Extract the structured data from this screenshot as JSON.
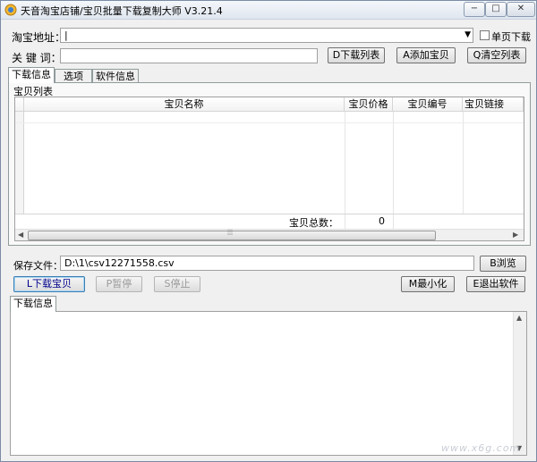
{
  "window": {
    "title": "天音淘宝店铺/宝贝批量下载复制大师 V3.21.4",
    "minimize": "−",
    "maximize": "□",
    "close": "✕"
  },
  "form": {
    "url_label": "淘宝地址：",
    "url_value": "|",
    "single_page_label": "单页下载",
    "keyword_label": "关 键 词：",
    "keyword_value": ""
  },
  "buttons": {
    "download_list": "D下载列表",
    "add_item": "A添加宝贝",
    "clear_list": "Q清空列表",
    "browse": "B浏览",
    "download_items": "L下载宝贝",
    "pause": "P暂停",
    "stop": "S停止",
    "minimize": "M最小化",
    "exit": "E退出软件"
  },
  "tabs": [
    "下载信息",
    "选项",
    "软件信息"
  ],
  "item_list": {
    "group_label": "宝贝列表",
    "columns": [
      "宝贝名称",
      "宝贝价格",
      "宝贝编号",
      "宝贝链接"
    ],
    "total_label": "宝贝总数：",
    "total_value": "0"
  },
  "save": {
    "label": "保存文件：",
    "path": "D:\\1\\csv12271558.csv"
  },
  "log": {
    "tab_label": "下载信息"
  },
  "watermark": "www.x6g.com"
}
